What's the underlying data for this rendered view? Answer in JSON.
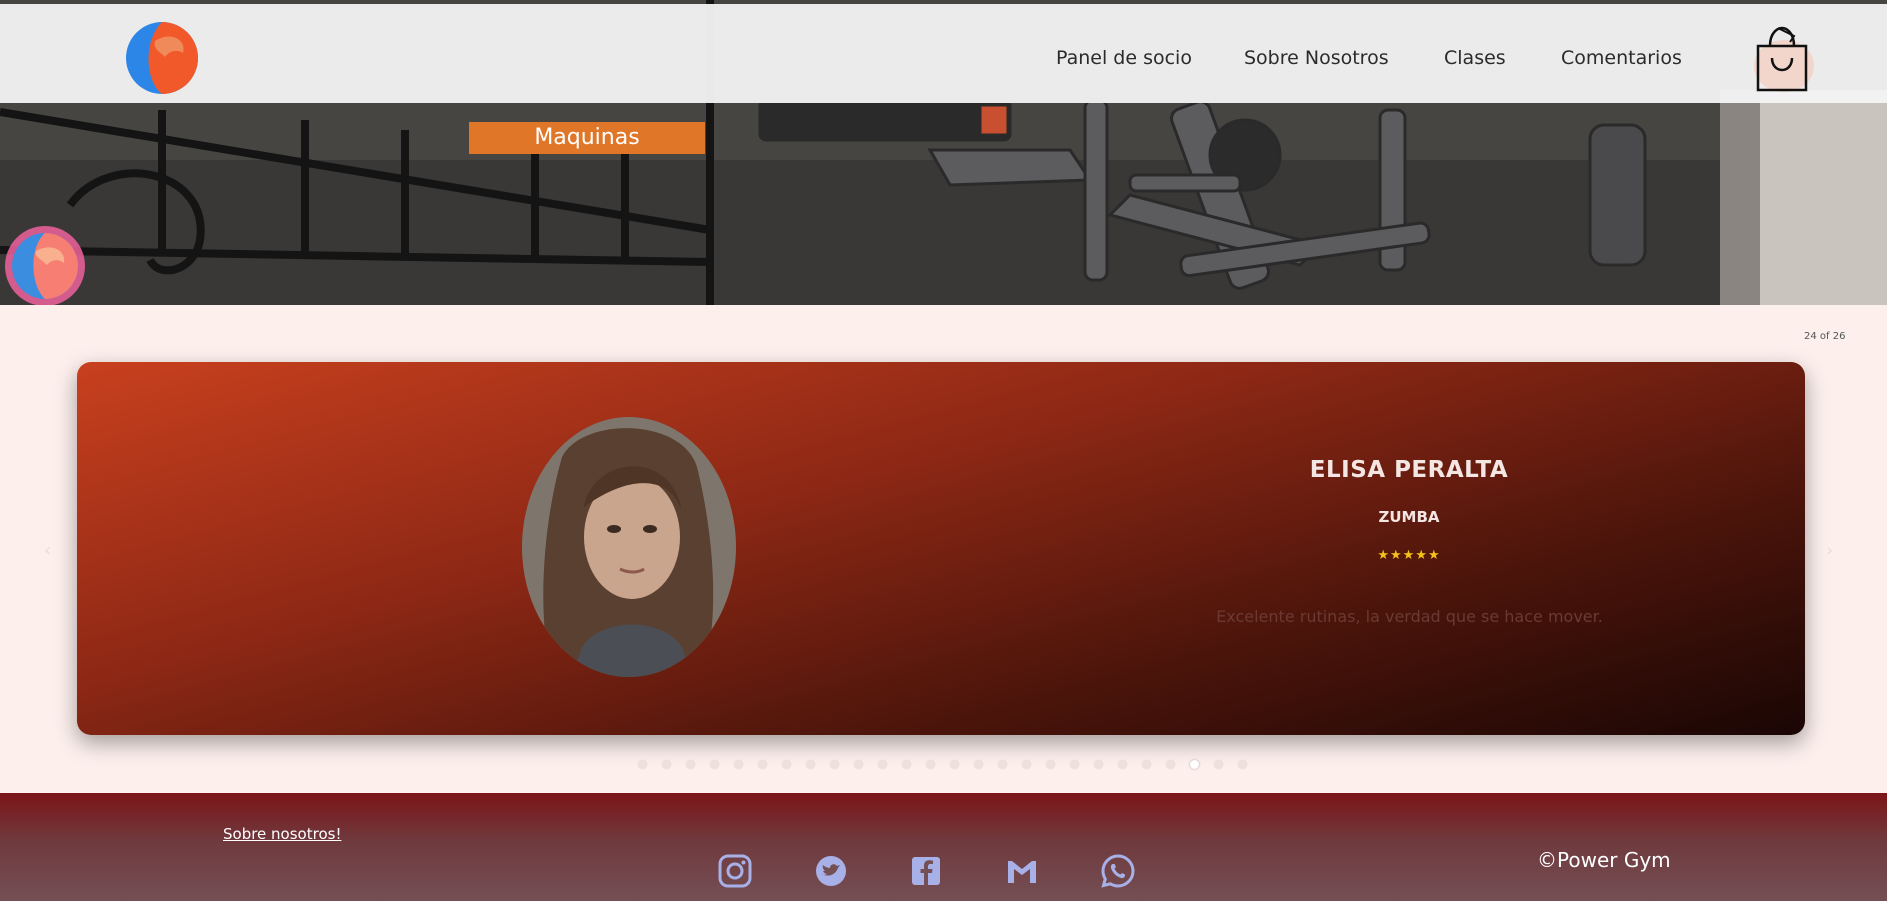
{
  "header": {
    "nav": [
      {
        "label": "Panel de socio"
      },
      {
        "label": "Sobre Nosotros"
      },
      {
        "label": "Clases"
      },
      {
        "label": "Comentarios"
      }
    ]
  },
  "hero": {
    "category_label": "Maquinas"
  },
  "carousel": {
    "counter": "24 of 26",
    "total_slides": 26,
    "active_index": 23,
    "slide": {
      "name": "ELISA PERALTA",
      "class_name": "ZUMBA",
      "rating": 5,
      "stars": "★★★★★",
      "comment": "Excelente rutinas, la verdad que se hace mover."
    }
  },
  "footer": {
    "about_link": "Sobre nosotros!",
    "social": [
      "instagram-icon",
      "twitter-icon",
      "facebook-icon",
      "gmail-icon",
      "whatsapp-icon"
    ],
    "copyright": "©Power Gym"
  },
  "colors": {
    "accent_orange": "#e07628",
    "card_gradient_start": "#c8401e",
    "card_gradient_end": "#1a0604",
    "footer_red": "#7c1418",
    "star": "#f5c21a",
    "page_bg": "#fcefec"
  }
}
